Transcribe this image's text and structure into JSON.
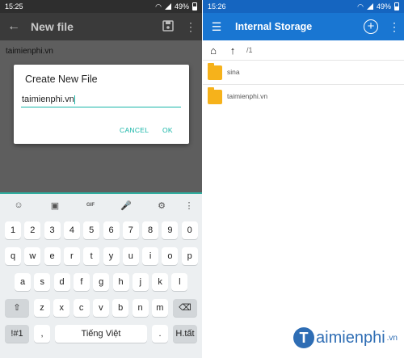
{
  "left": {
    "status": {
      "time": "15:25",
      "battery": "49%"
    },
    "toolbar": {
      "title": "New file"
    },
    "content_text": "taimienphi.vn",
    "dialog": {
      "title": "Create New File",
      "input_value": "taimienphi.vn",
      "cancel": "CANCEL",
      "ok": "OK"
    },
    "keyboard": {
      "toolbar_icons": [
        "emoji-icon",
        "sticker-icon",
        "gif-icon",
        "mic-icon",
        "settings-icon",
        "more-icon"
      ],
      "gif": "GIF",
      "row_numbers": [
        "1",
        "2",
        "3",
        "4",
        "5",
        "6",
        "7",
        "8",
        "9",
        "0"
      ],
      "row1": [
        "q",
        "w",
        "e",
        "r",
        "t",
        "y",
        "u",
        "i",
        "o",
        "p"
      ],
      "row2": [
        "a",
        "s",
        "d",
        "f",
        "g",
        "h",
        "j",
        "k",
        "l"
      ],
      "row3": [
        "z",
        "x",
        "c",
        "v",
        "b",
        "n",
        "m"
      ],
      "sym": "!#1",
      "comma": ",",
      "space": "Tiếng Việt",
      "dot": ".",
      "enter": "H.tất"
    }
  },
  "right": {
    "status": {
      "time": "15:26",
      "battery": "49%"
    },
    "toolbar": {
      "title": "Internal Storage"
    },
    "path": "/",
    "path_suffix": "1",
    "files": [
      {
        "name": "sina"
      },
      {
        "name": "taimienphi.vn"
      }
    ],
    "watermark": {
      "letter": "T",
      "text": "aimienphi",
      "suffix": ".vn"
    }
  },
  "colors": {
    "accent_teal": "#18b6a8",
    "primary_blue": "#1976d2",
    "folder": "#f6b21b"
  }
}
